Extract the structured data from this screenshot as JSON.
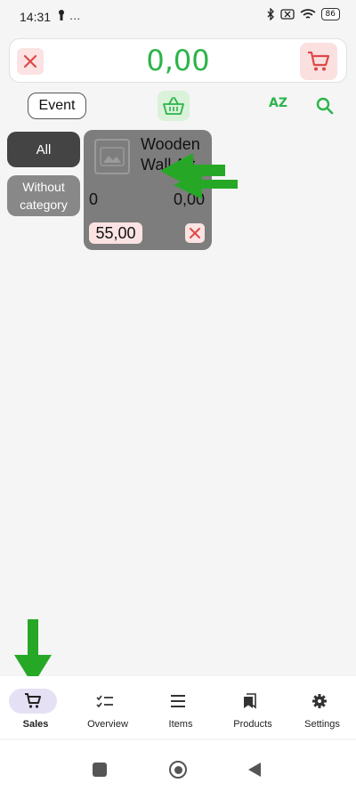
{
  "status_bar": {
    "time": "14:31",
    "left_icons": "…",
    "battery": "86"
  },
  "total_bar": {
    "total": "0,00"
  },
  "toolbar": {
    "event_label": "Event",
    "sort_label": "AZ"
  },
  "categories": [
    {
      "label": "All",
      "selected": true
    },
    {
      "label": "Without category",
      "selected": false
    }
  ],
  "product": {
    "name": "Wooden Wall Art",
    "stock": "0",
    "sold": "0,00",
    "price": "55,00"
  },
  "bottom_nav": [
    {
      "label": "Sales",
      "icon": "cart-icon",
      "active": true
    },
    {
      "label": "Overview",
      "icon": "checklist-icon",
      "active": false
    },
    {
      "label": "Items",
      "icon": "list-icon",
      "active": false
    },
    {
      "label": "Products",
      "icon": "bookmark-icon",
      "active": false
    },
    {
      "label": "Settings",
      "icon": "gear-icon",
      "active": false
    }
  ],
  "colors": {
    "accent_green": "#2bb44a",
    "danger_bg": "#fbe3e3",
    "card_bg": "#7d7d7d",
    "annotation_arrow": "#26a826"
  }
}
